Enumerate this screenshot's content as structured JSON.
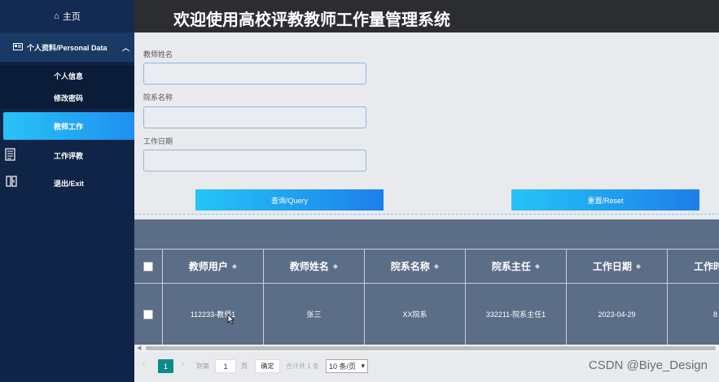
{
  "header": {
    "title": "欢迎使用高校评教教师工作量管理系统"
  },
  "sidebar": {
    "home": "主页",
    "group": "个人资料/Personal Data",
    "subitems": [
      "个人信息",
      "修改密码",
      "教师工作"
    ],
    "items": [
      "工作评教",
      "退出/Exit"
    ]
  },
  "form": {
    "fields": [
      {
        "label": "教师姓名",
        "value": ""
      },
      {
        "label": "院系名称",
        "value": ""
      },
      {
        "label": "工作日期",
        "value": ""
      }
    ],
    "query_label": "查询/Query",
    "reset_label": "重置/Reset"
  },
  "table": {
    "columns": [
      "教师用户",
      "教师姓名",
      "院系名称",
      "院系主任",
      "工作日期",
      "工作时"
    ],
    "rows": [
      [
        "112233-教师1",
        "张三",
        "XX院系",
        "332211-院系主任1",
        "2023-04-29",
        "8"
      ]
    ]
  },
  "pager": {
    "current": "1",
    "goto_label": "到第",
    "page_input": "1",
    "page_label": "页",
    "ok_label": "确定",
    "total": "合计共 1 条",
    "size": "10 条/页"
  },
  "watermark": "CSDN @Biye_Design",
  "colors": {
    "sidebar": "#0f2446",
    "accent": "#27c3f5",
    "header": "#2b2d30",
    "table": "#5c6d88",
    "pager_active": "#0b8a8a"
  }
}
